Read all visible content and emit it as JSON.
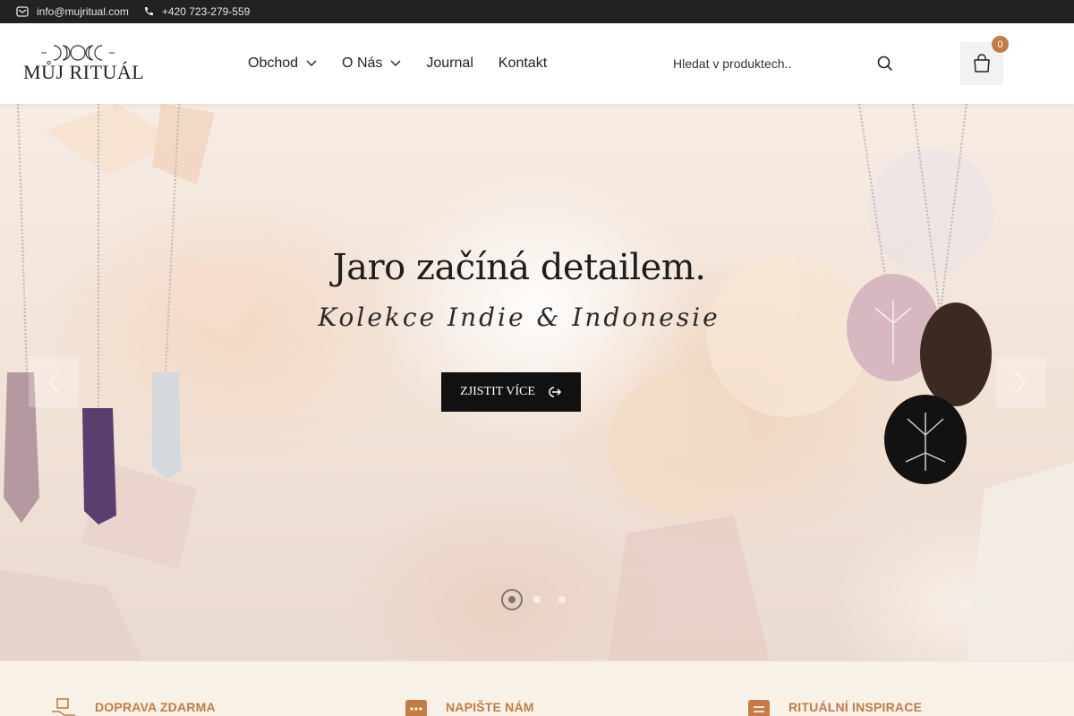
{
  "topbar": {
    "email": "info@mujritual.com",
    "phone": "+420 723-279-559"
  },
  "header": {
    "logo_text": "MŮJ RITUÁL",
    "nav": [
      {
        "label": "Obchod",
        "has_dropdown": true
      },
      {
        "label": "O Nás",
        "has_dropdown": true
      },
      {
        "label": "Journal",
        "has_dropdown": false
      },
      {
        "label": "Kontakt",
        "has_dropdown": false
      }
    ],
    "search_placeholder": "Hledat v produktech..",
    "cart_count": "0"
  },
  "hero": {
    "title": "Jaro začíná detailem.",
    "subtitle": "Kolekce Indie & Indonesie",
    "cta_label": "ZJISTIT VÍCE",
    "slides_total": 3,
    "active_slide": 1
  },
  "features": [
    {
      "title": "DOPRAVA ZDARMA",
      "icon": "delivery-icon"
    },
    {
      "title": "NAPIŠTE NÁM",
      "icon": "chat-icon"
    },
    {
      "title": "RITUÁLNÍ INSPIRACE",
      "icon": "note-icon"
    }
  ],
  "colors": {
    "topbar_bg": "#222222",
    "accent": "#c47c43",
    "features_bg": "#f8f1e7",
    "cta_bg": "#111111"
  }
}
